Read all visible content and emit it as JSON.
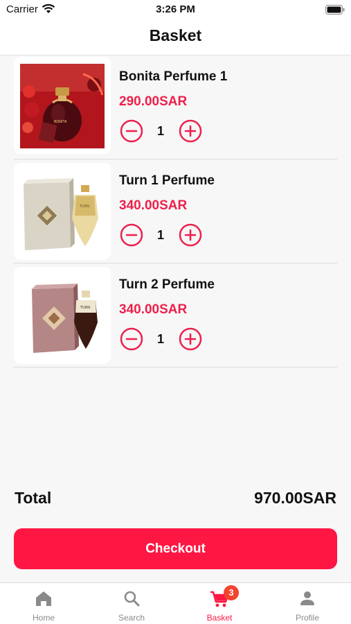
{
  "status_bar": {
    "carrier": "Carrier",
    "time": "3:26 PM"
  },
  "header": {
    "title": "Basket"
  },
  "basket": {
    "items": [
      {
        "name": "Bonita Perfume 1",
        "price": "290.00SAR",
        "quantity": "1"
      },
      {
        "name": "Turn 1 Perfume",
        "price": "340.00SAR",
        "quantity": "1"
      },
      {
        "name": "Turn 2 Perfume",
        "price": "340.00SAR",
        "quantity": "1"
      }
    ]
  },
  "summary": {
    "total_label": "Total",
    "total_value": "970.00SAR"
  },
  "checkout": {
    "label": "Checkout"
  },
  "tabbar": {
    "tabs": [
      {
        "label": "Home",
        "icon": "home-icon"
      },
      {
        "label": "Search",
        "icon": "search-icon"
      },
      {
        "label": "Basket",
        "icon": "cart-icon",
        "badge": "3",
        "active": true
      },
      {
        "label": "Profile",
        "icon": "person-icon"
      }
    ]
  },
  "colors": {
    "accent": "#ff1744",
    "price": "#ee1f4b",
    "badge": "#f4432e",
    "inactive_tab": "#8a8a8a"
  }
}
